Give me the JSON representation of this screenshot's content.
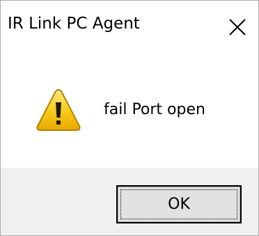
{
  "window": {
    "title": "IR Link PC Agent"
  },
  "message": {
    "text": "fail Port open",
    "icon": "warning-icon"
  },
  "buttons": {
    "ok_label": "OK",
    "close_icon": "close-icon"
  },
  "colors": {
    "footer_bg": "#f0f0f0",
    "warning_yellow": "#f4c414"
  }
}
